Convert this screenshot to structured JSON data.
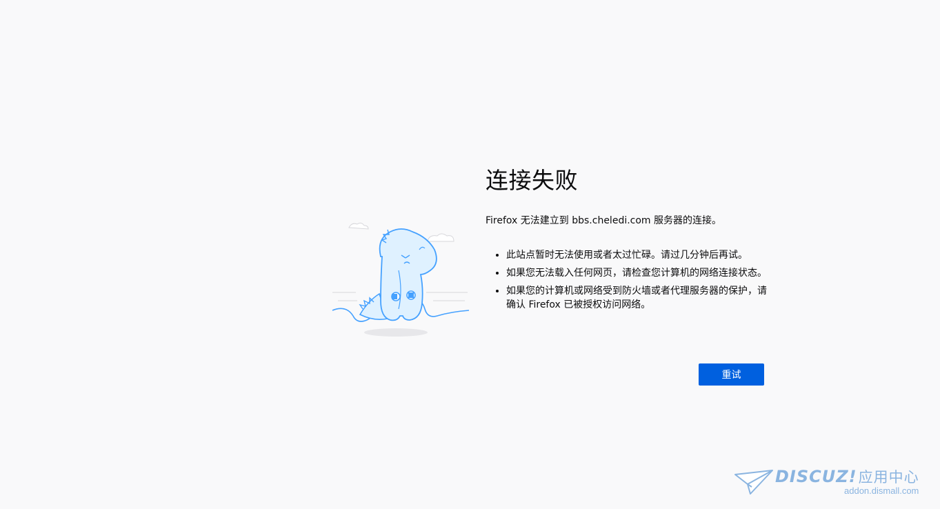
{
  "error_page": {
    "title": "连接失败",
    "intro": "Firefox 无法建立到 bbs.cheledi.com 服务器的连接。",
    "reasons": [
      "此站点暂时无法使用或者太过忙碌。请过几分钟后再试。",
      "如果您无法载入任何网页，请检查您计算机的网络连接状态。",
      "如果您的计算机或网络受到防火墙或者代理服务器的保护，请确认 Firefox 已被授权访问网络。"
    ],
    "retry_label": "重试"
  },
  "watermark": {
    "brand": "DISCUZ!",
    "suffix": "应用中心",
    "url": "addon.dismall.com"
  },
  "colors": {
    "background": "#f9f9fa",
    "accent": "#0060df",
    "illustration_stroke": "#45a1ff",
    "illustration_fill": "#dff1ff",
    "watermark": "#8ab4e0"
  },
  "icons": {
    "illustration": "disconnected-dinosaur-icon",
    "watermark_logo": "paper-plane-icon"
  }
}
